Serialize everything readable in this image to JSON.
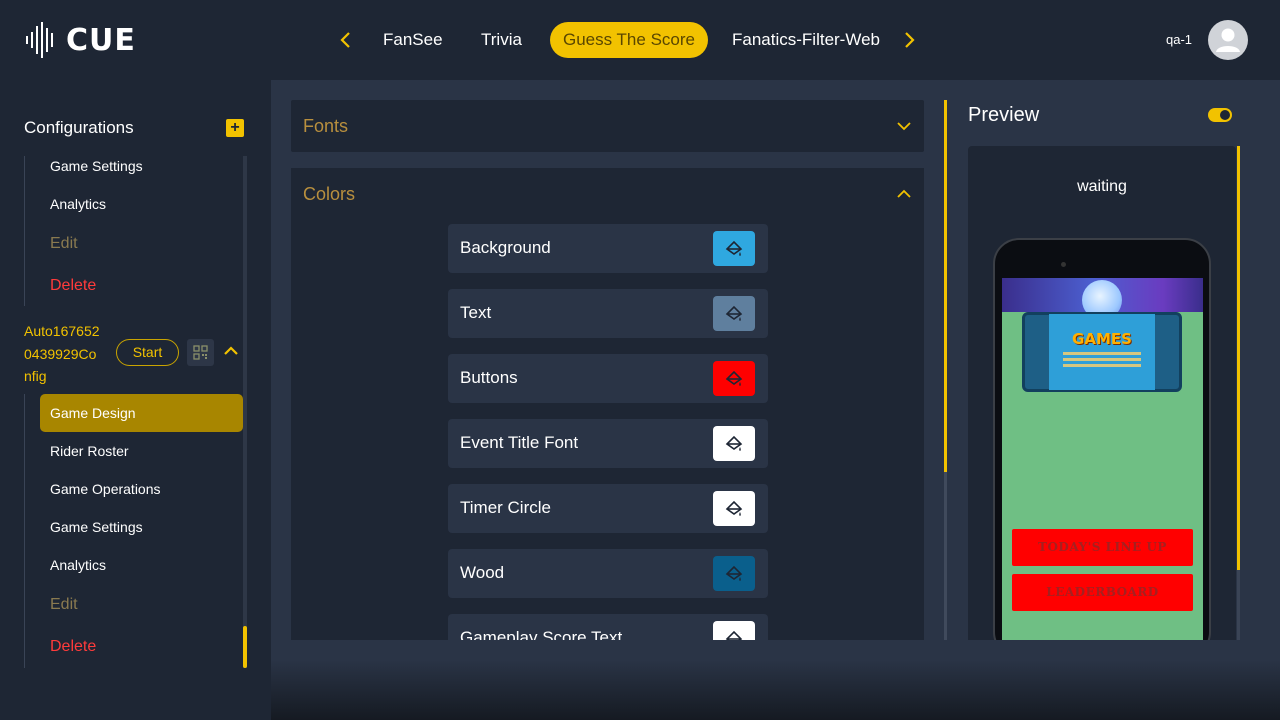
{
  "app": {
    "logo_text": "CUE",
    "user_name": "qa-1"
  },
  "nav": {
    "tabs": [
      {
        "label": "FanSee"
      },
      {
        "label": "Trivia"
      },
      {
        "label": "Guess The Score",
        "active": true
      },
      {
        "label": "Fanatics-Filter-Web"
      }
    ]
  },
  "sidebar": {
    "title": "Configurations",
    "top_items": [
      {
        "label": "Game Settings"
      },
      {
        "label": "Analytics"
      },
      {
        "label": "Edit"
      },
      {
        "label": "Delete"
      }
    ],
    "config": {
      "name": "Auto1676520439929Config",
      "name_lines": [
        "Auto167652",
        "0439929Co",
        "nfig"
      ],
      "start_label": "Start"
    },
    "config_items": [
      {
        "label": "Game Design",
        "active": true
      },
      {
        "label": "Rider Roster"
      },
      {
        "label": "Game Operations"
      },
      {
        "label": "Game Settings"
      },
      {
        "label": "Analytics"
      },
      {
        "label": "Edit"
      },
      {
        "label": "Delete"
      }
    ]
  },
  "main": {
    "fonts_title": "Fonts",
    "colors_title": "Colors",
    "colors": [
      {
        "label": "Background",
        "color": "#2fa8e0"
      },
      {
        "label": "Text",
        "color": "#5f7f9e"
      },
      {
        "label": "Buttons",
        "color": "#ff0000"
      },
      {
        "label": "Event Title Font",
        "color": "#ffffff"
      },
      {
        "label": "Timer Circle",
        "color": "#ffffff"
      },
      {
        "label": "Wood",
        "color": "#0a5f8c"
      },
      {
        "label": "Gameplay Score Text",
        "color": "#ffffff"
      }
    ]
  },
  "preview": {
    "title": "Preview",
    "status": "waiting",
    "games_title": "GAMES",
    "buttons": [
      "TODAY'S LINE UP",
      "LEADERBOARD"
    ]
  },
  "theme": {
    "accent": "#f2c200",
    "delete": "#ff3b3b",
    "bg": "#1e2634"
  }
}
